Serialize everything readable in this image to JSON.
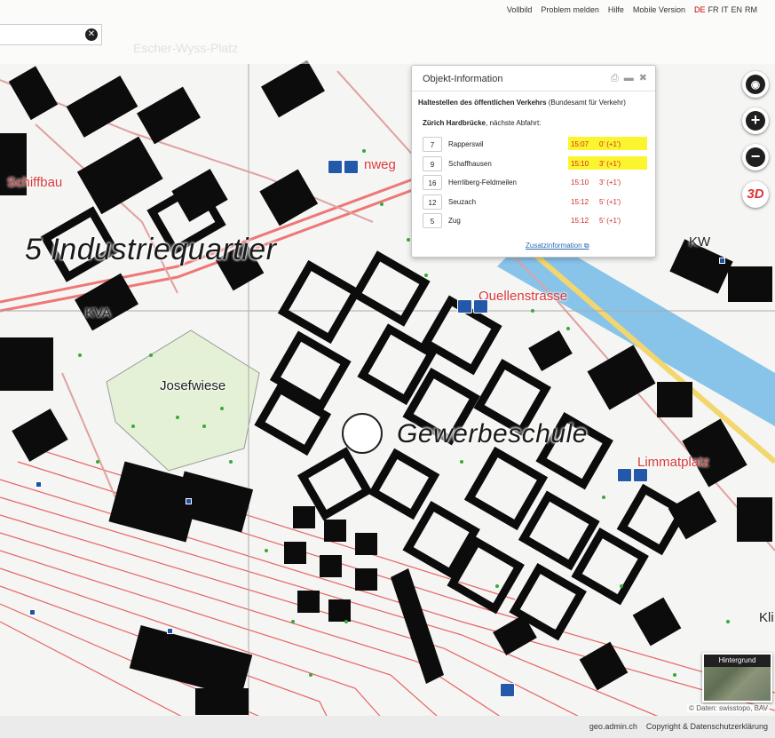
{
  "topbar": {
    "links": [
      "Vollbild",
      "Problem melden",
      "Hilfe",
      "Mobile Version"
    ],
    "languages": [
      "DE",
      "FR",
      "IT",
      "EN",
      "RM"
    ],
    "active_language": "DE",
    "search_value": "",
    "search_clear_icon": "close-icon"
  },
  "map_labels": {
    "district": "5 Industriequartier",
    "gewerbeschule": "Gewerbeschule",
    "quellenstrasse": "Quellenstrasse",
    "limmatplatz": "Limmatplatz",
    "josefwiese": "Josefwiese",
    "kva": "KVA",
    "kw": "KW",
    "schiffbau": "Schiffbau",
    "street_partial_top": "nweg",
    "top_faint": "Escher-Wyss-Platz",
    "right_edge": "Kli"
  },
  "popup": {
    "title": "Objekt-Information",
    "layer_name": "Haltestellen des öffentlichen Verkehrs",
    "layer_source": "(Bundesamt für Verkehr)",
    "stop_name": "Zürich Hardbrücke",
    "stop_suffix": ", nächste Abfahrt:",
    "departures": [
      {
        "line": "7",
        "destination": "Rapperswil",
        "time": "15:07",
        "delay": "0'  (+1')",
        "highlight": true
      },
      {
        "line": "9",
        "destination": "Schaffhausen",
        "time": "15:10",
        "delay": "3'  (+1')",
        "highlight": true
      },
      {
        "line": "16",
        "destination": "Herrliberg-Feldmeilen",
        "time": "15:10",
        "delay": "3'  (+1')",
        "highlight": false
      },
      {
        "line": "12",
        "destination": "Seuzach",
        "time": "15:12",
        "delay": "5'  (+1')",
        "highlight": false
      },
      {
        "line": "5",
        "destination": "Zug",
        "time": "15:12",
        "delay": "5'  (+1')",
        "highlight": false
      }
    ],
    "more_info": "Zusatzinformation"
  },
  "map_controls": {
    "threed_label": "3D",
    "zoom_in_label": "+",
    "zoom_out_label": "−",
    "background_label": "Hintergrund"
  },
  "footer": {
    "attribution": "© Daten: swisstopo, BAV",
    "links": [
      "geo.admin.ch",
      "Copyright & Datenschutzerklärung"
    ]
  },
  "colors": {
    "rail": "#e05a5a",
    "road": "#ef8f8f",
    "highway": "#f2d66e",
    "water": "#88c3ea",
    "park": "#e7f3dc",
    "tram_stop": "#2458a8",
    "highlight": "#fbf530"
  }
}
